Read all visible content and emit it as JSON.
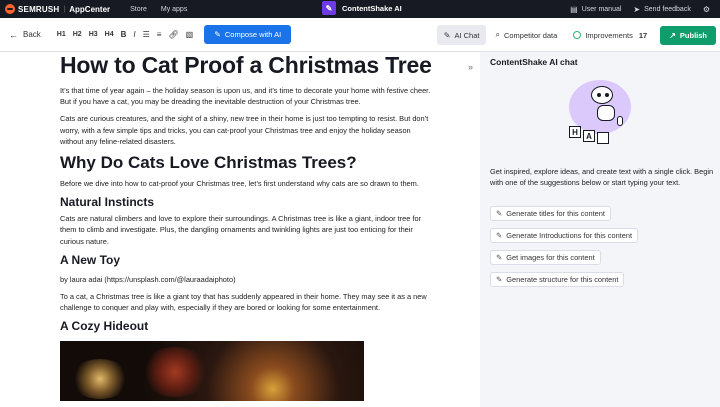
{
  "topbar": {
    "brand": "SEMRUSH",
    "brand_sub": "AppCenter",
    "nav": [
      "Store",
      "My apps"
    ],
    "app_title": "ContentShake AI",
    "user_manual": "User manual",
    "send_feedback": "Send feedback"
  },
  "toolbar": {
    "back": "Back",
    "headings": [
      "H1",
      "H2",
      "H3",
      "H4"
    ],
    "compose": "Compose with AI",
    "tabs": {
      "ai_chat": "AI Chat",
      "competitor": "Competitor data",
      "improvements": "Improvements",
      "improvements_count": "17"
    },
    "publish": "Publish"
  },
  "article": {
    "title": "How to Cat Proof a Christmas Tree",
    "intro1": "It’s that time of year again – the holiday season is upon us, and it’s time to decorate your home with festive cheer. But if you have a cat, you may be dreading the inevitable destruction of your Christmas tree.",
    "intro2": "Cats are curious creatures, and the sight of a shiny, new tree in their home is just too tempting to resist. But don’t worry, with a few simple tips and tricks, you can cat-proof your Christmas tree and enjoy the holiday season without any feline-related disasters.",
    "h2": "Why Do Cats Love Christmas Trees?",
    "p_why": "Before we dive into how to cat-proof your Christmas tree, let’s first understand why cats are so drawn to them.",
    "h3_1": "Natural Instincts",
    "p_instincts": "Cats are natural climbers and love to explore their surroundings. A Christmas tree is like a giant, indoor tree for them to climb and investigate. Plus, the dangling ornaments and twinkling lights are just too enticing for their curious nature.",
    "h3_2": "A New Toy",
    "credit": "by laura adai (https://unsplash.com/@lauraadaiphoto)",
    "p_toy": "To a cat, a Christmas tree is like a giant toy that has suddenly appeared in their home. They may see it as a new challenge to conquer and play with, especially if they are bored or looking for some entertainment.",
    "h3_3": "A Cozy Hideout"
  },
  "chat": {
    "title": "ContentShake AI chat",
    "block_letters": [
      "H",
      "A"
    ],
    "intro": "Get inspired, explore ideas, and create text with a single click. Begin with one of the suggestions below or start typing your text.",
    "suggestions": [
      "Generate titles for this content",
      "Generate Introductions for this content",
      "Get images for this content",
      "Generate structure for this content"
    ]
  },
  "icons": {
    "logo": "semrush-flame-icon",
    "app": "contentshake-icon",
    "manual": "book-icon",
    "feedback": "send-icon",
    "settings": "gear-icon",
    "compose": "pencil-icon",
    "collapse": "double-chevron-right-icon"
  },
  "colors": {
    "compose": "#1a73e8",
    "publish": "#0f9d6c",
    "topbar": "#171a22",
    "chat_bg": "#f4f5f9"
  }
}
